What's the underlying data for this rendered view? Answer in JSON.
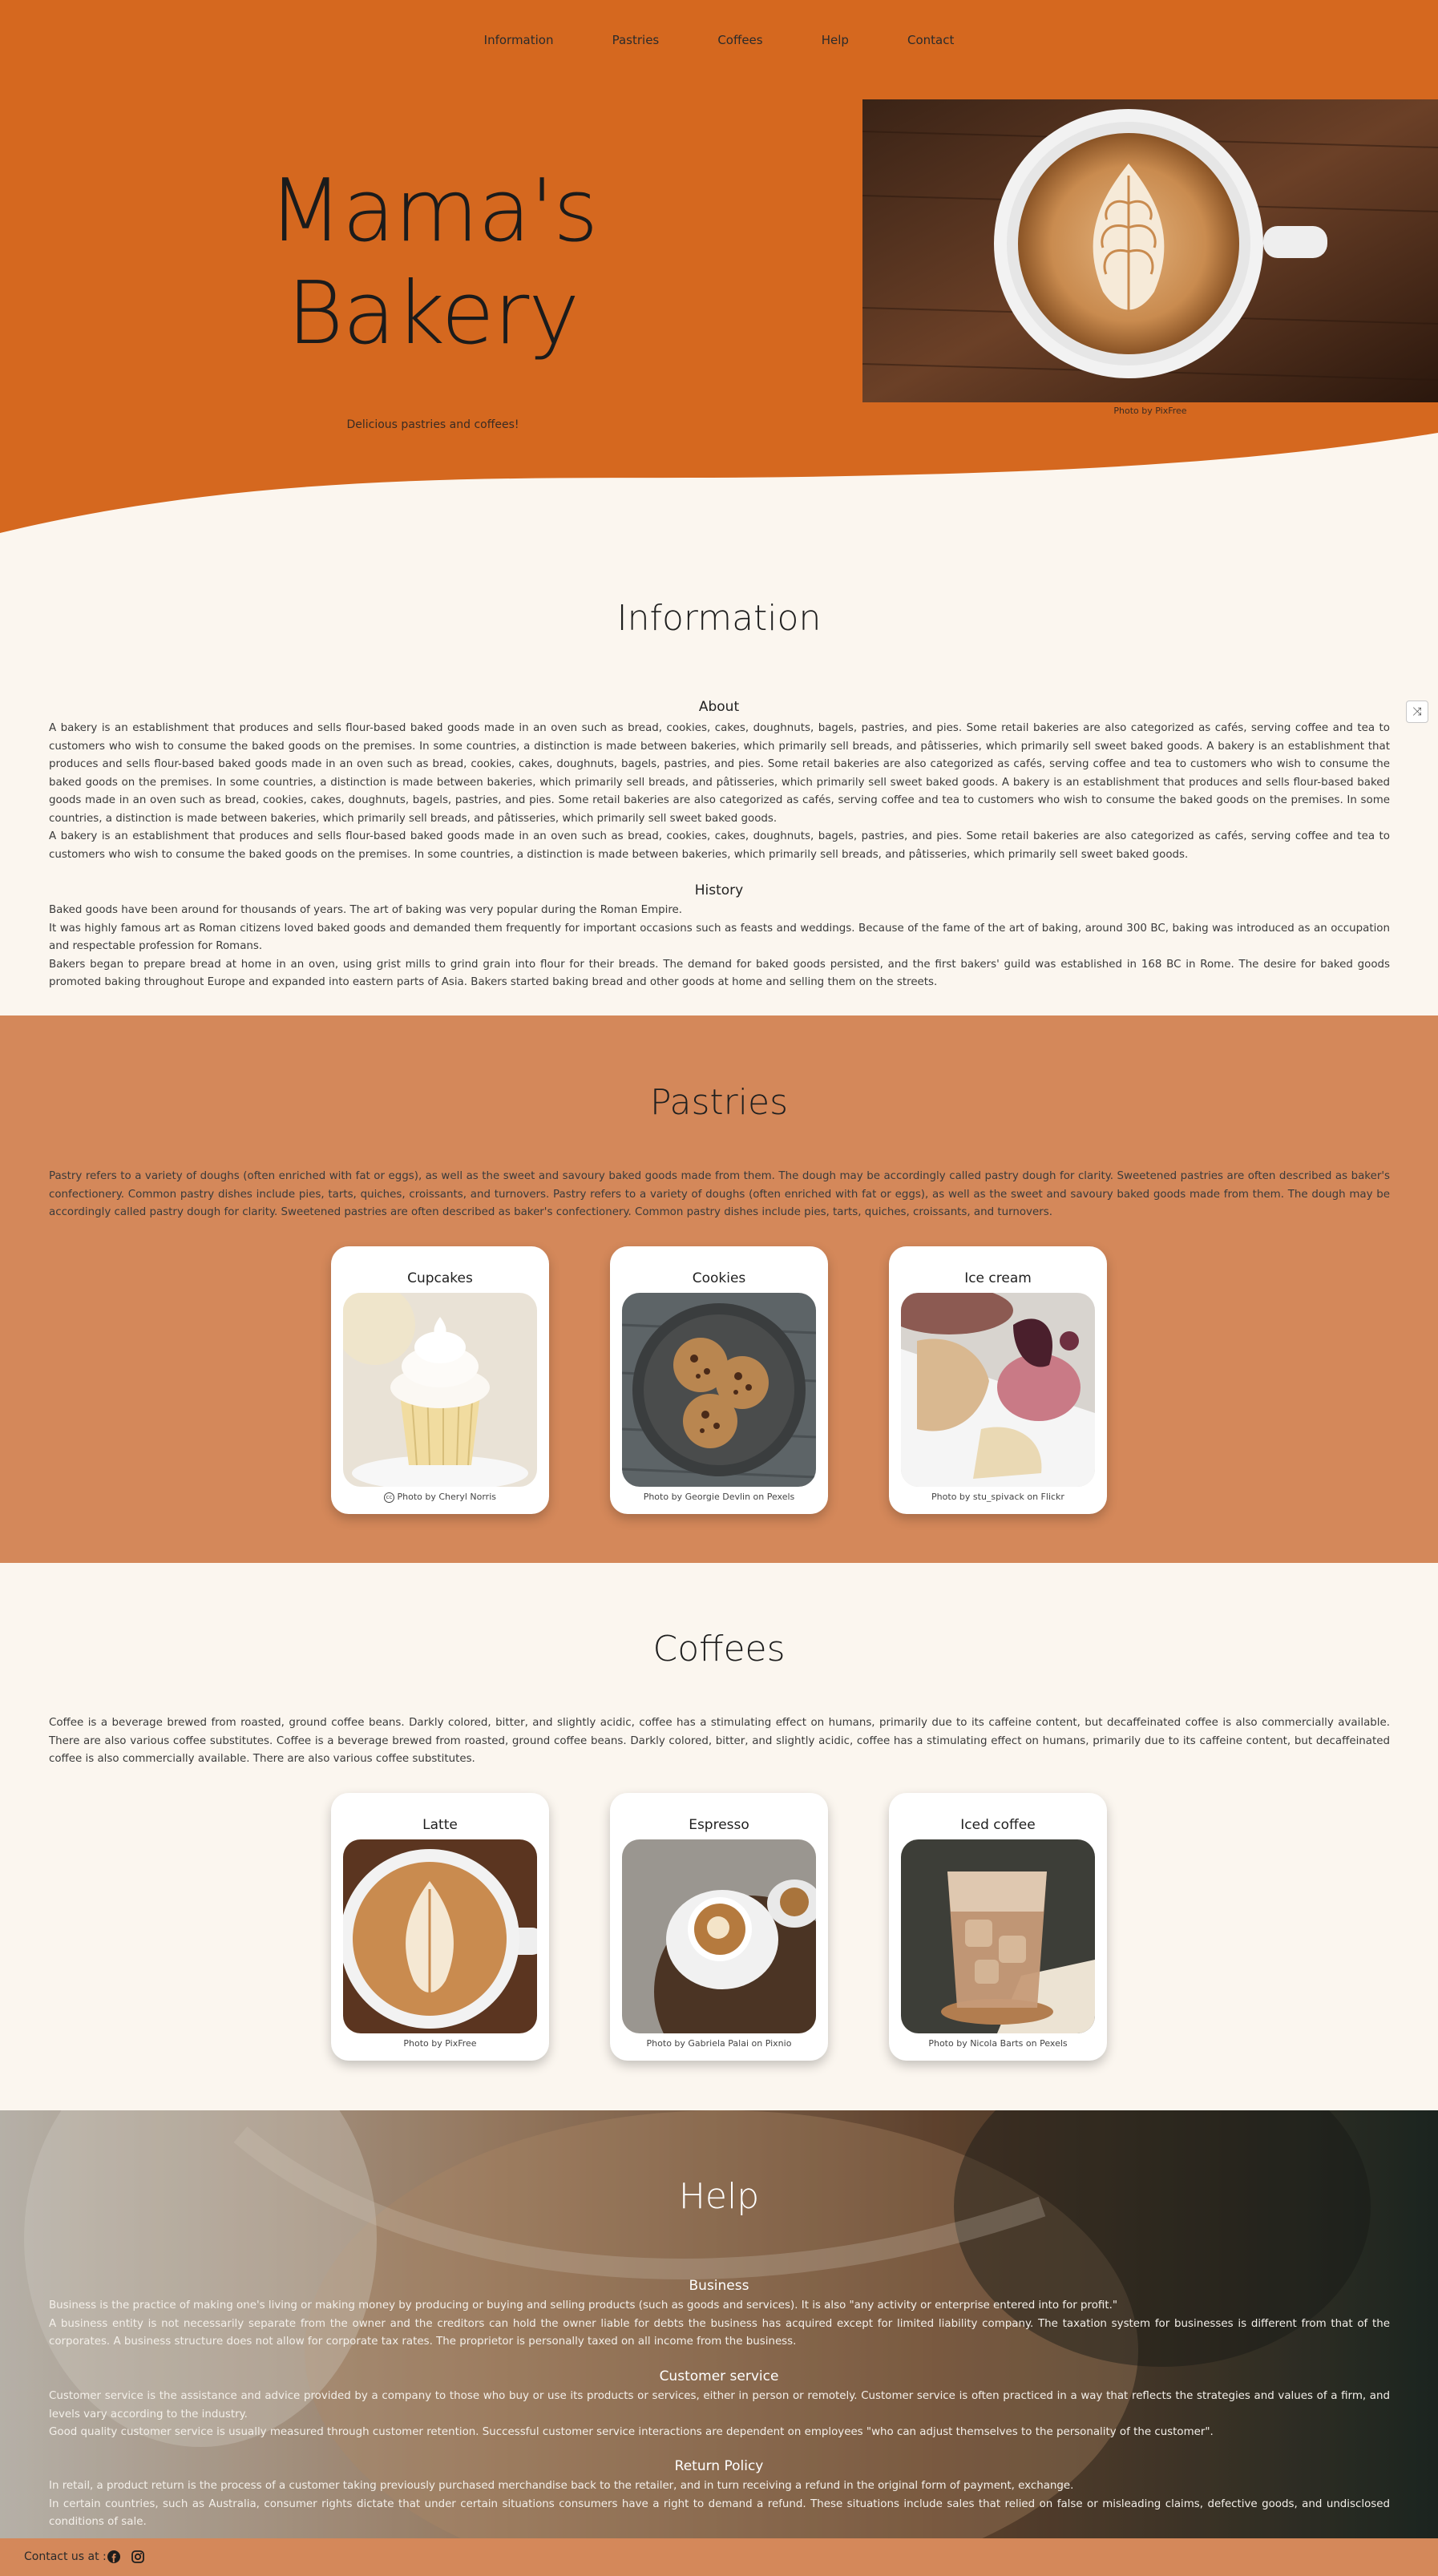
{
  "nav": [
    "Information",
    "Pastries",
    "Coffees",
    "Help",
    "Contact"
  ],
  "hero": {
    "title": "Mama's Bakery",
    "tagline": "Delicious pastries and coffees!",
    "photo_credit": "Photo by PixFree"
  },
  "information": {
    "title": "Information",
    "about_heading": "About",
    "about_text": [
      "A bakery is an establishment that produces and sells flour-based baked goods made in an oven such as bread, cookies, cakes, doughnuts, bagels, pastries, and pies. Some retail bakeries are also categorized as cafés, serving coffee and tea to customers who wish to consume the baked goods on the premises. In some countries, a distinction is made between bakeries, which primarily sell breads, and pâtisseries, which primarily sell sweet baked goods. A bakery is an establishment that produces and sells flour-based baked goods made in an oven such as bread, cookies, cakes, doughnuts, bagels, pastries, and pies. Some retail bakeries are also categorized as cafés, serving coffee and tea to customers who wish to consume the baked goods on the premises. In some countries, a distinction is made between bakeries, which primarily sell breads, and pâtisseries, which primarily sell sweet baked goods. A bakery is an establishment that produces and sells flour-based baked goods made in an oven such as bread, cookies, cakes, doughnuts, bagels, pastries, and pies. Some retail bakeries are also categorized as cafés, serving coffee and tea to customers who wish to consume the baked goods on the premises. In some countries, a distinction is made between bakeries, which primarily sell breads, and pâtisseries, which primarily sell sweet baked goods.",
      "A bakery is an establishment that produces and sells flour-based baked goods made in an oven such as bread, cookies, cakes, doughnuts, bagels, pastries, and pies. Some retail bakeries are also categorized as cafés, serving coffee and tea to customers who wish to consume the baked goods on the premises. In some countries, a distinction is made between bakeries, which primarily sell breads, and pâtisseries, which primarily sell sweet baked goods."
    ],
    "history_heading": "History",
    "history_text": [
      "Baked goods have been around for thousands of years. The art of baking was very popular during the Roman Empire.",
      "It was highly famous art as Roman citizens loved baked goods and demanded them frequently for important occasions such as feasts and weddings. Because of the fame of the art of baking, around 300 BC, baking was introduced as an occupation and respectable profession for Romans.",
      "Bakers began to prepare bread at home in an oven, using grist mills to grind grain into flour for their breads. The demand for baked goods persisted, and the first bakers' guild was established in 168 BC in Rome. The desire for baked goods promoted baking throughout Europe and expanded into eastern parts of Asia. Bakers started baking bread and other goods at home and selling them on the streets."
    ]
  },
  "pastries": {
    "title": "Pastries",
    "text": "Pastry refers to a variety of doughs (often enriched with fat or eggs), as well as the sweet and savoury baked goods made from them. The dough may be accordingly called pastry dough for clarity. Sweetened pastries are often described as baker's confectionery. Common pastry dishes include pies, tarts, quiches, croissants, and turnovers. Pastry refers to a variety of doughs (often enriched with fat or eggs), as well as the sweet and savoury baked goods made from them. The dough may be accordingly called pastry dough for clarity. Sweetened pastries are often described as baker's confectionery. Common pastry dishes include pies, tarts, quiches, croissants, and turnovers.",
    "cards": [
      {
        "name": "Cupcakes",
        "credit": "Photo by Cheryl Norris"
      },
      {
        "name": "Cookies",
        "credit": "Photo by Georgie Devlin on Pexels"
      },
      {
        "name": "Ice cream",
        "credit": "Photo by stu_spivack on Flickr"
      }
    ]
  },
  "coffees": {
    "title": "Coffees",
    "text": "Coffee is a beverage brewed from roasted, ground coffee beans. Darkly colored, bitter, and slightly acidic, coffee has a stimulating effect on humans, primarily due to its caffeine content, but decaffeinated coffee is also commercially available. There are also various coffee substitutes. Coffee is a beverage brewed from roasted, ground coffee beans. Darkly colored, bitter, and slightly acidic, coffee has a stimulating effect on humans, primarily due to its caffeine content, but decaffeinated coffee is also commercially available. There are also various coffee substitutes.",
    "cards": [
      {
        "name": "Latte",
        "credit": "Photo by PixFree"
      },
      {
        "name": "Espresso",
        "credit": "Photo by Gabriela Palai on Pixnio"
      },
      {
        "name": "Iced coffee",
        "credit": "Photo by Nicola Barts on Pexels"
      }
    ]
  },
  "help": {
    "title": "Help",
    "business_heading": "Business",
    "business_text": [
      "Business is the practice of making one's living or making money by producing or buying and selling products (such as goods and services). It is also \"any activity or enterprise entered into for profit.\"",
      "A business entity is not necessarily separate from the owner and the creditors can hold the owner liable for debts the business has acquired except for limited liability company. The taxation system for businesses is different from that of the corporates. A business structure does not allow for corporate tax rates. The proprietor is personally taxed on all income from the business."
    ],
    "service_heading": "Customer service",
    "service_text": [
      "Customer service is the assistance and advice provided by a company to those who buy or use its products or services, either in person or remotely. Customer service is often practiced in a way that reflects the strategies and values of a firm, and levels vary according to the industry.",
      "Good quality customer service is usually measured through customer retention. Successful customer service interactions are dependent on employees \"who can adjust themselves to the personality of the customer\"."
    ],
    "return_heading": "Return Policy",
    "return_text": [
      "In retail, a product return is the process of a customer taking previously purchased merchandise back to the retailer, and in turn receiving a refund in the original form of payment, exchange.",
      "In certain countries, such as Australia, consumer rights dictate that under certain situations consumers have a right to demand a refund. These situations include sales that relied on false or misleading claims, defective goods, and undisclosed conditions of sale."
    ]
  },
  "footer": {
    "label": "Contact us at :",
    "icons": [
      "facebook-icon",
      "instagram-icon"
    ]
  },
  "colors": {
    "hero": "#d5681f",
    "pastries_band": "#d4885a",
    "cream": "#fbf6ef"
  }
}
